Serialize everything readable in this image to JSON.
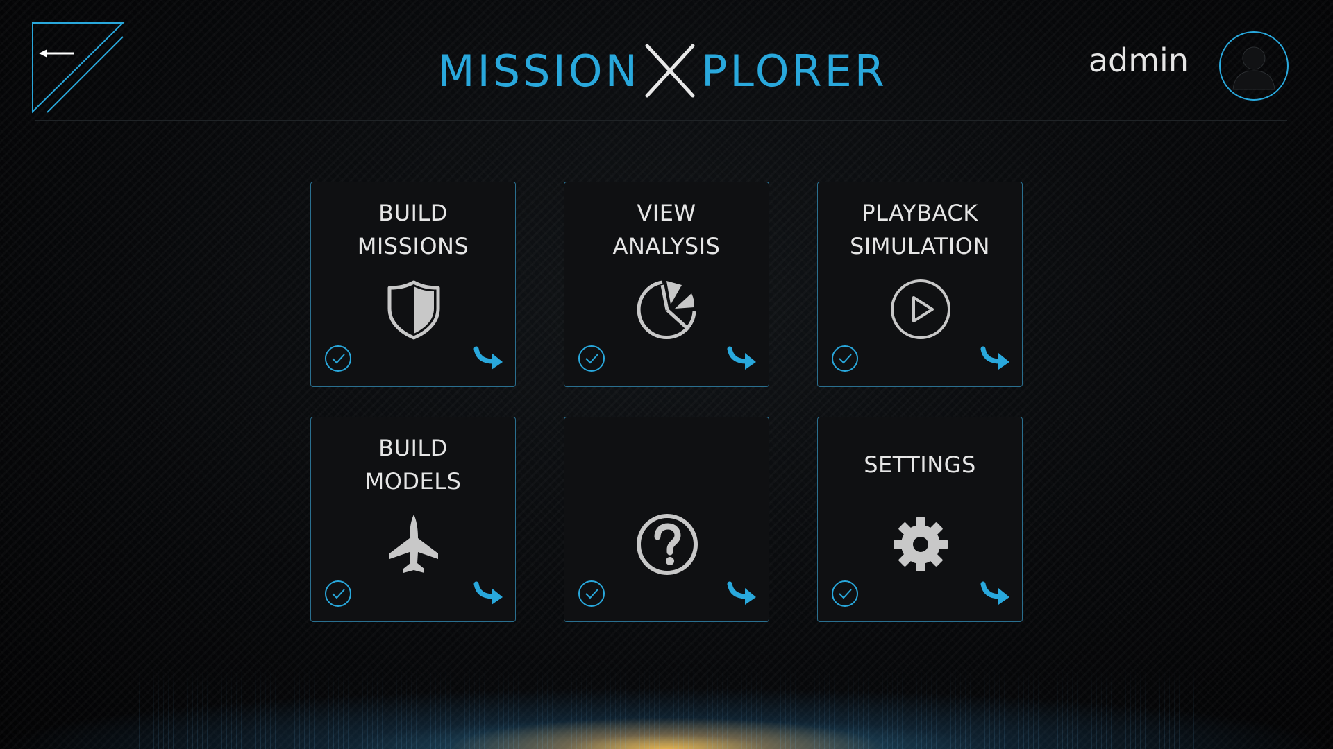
{
  "app": {
    "logo_left": "MISSION",
    "logo_x": "X",
    "logo_right": "PLORER"
  },
  "header": {
    "back_icon": "back-arrow-icon",
    "user_name": "admin",
    "avatar_icon": "user-silhouette-icon"
  },
  "colors": {
    "accent": "#29a8dc",
    "tile_border": "#2a6f8f",
    "tile_bg": "#0f1012",
    "text": "#e6e6e6",
    "icon_gray": "#c8c8c8"
  },
  "tiles": [
    {
      "title": "BUILD\nMISSIONS",
      "icon": "shield-icon",
      "check_icon": "check-circle-icon",
      "go_icon": "curved-arrow-icon"
    },
    {
      "title": "VIEW\nANALYSIS",
      "icon": "pie-chart-icon",
      "check_icon": "check-circle-icon",
      "go_icon": "curved-arrow-icon"
    },
    {
      "title": "PLAYBACK\nSIMULATION",
      "icon": "play-icon",
      "check_icon": "check-circle-icon",
      "go_icon": "curved-arrow-icon"
    },
    {
      "title": "BUILD\nMODELS",
      "icon": "jet-icon",
      "check_icon": "check-circle-icon",
      "go_icon": "curved-arrow-icon"
    },
    {
      "title": "",
      "icon": "question-icon",
      "check_icon": "check-circle-icon",
      "go_icon": "curved-arrow-icon"
    },
    {
      "title": "SETTINGS",
      "icon": "gear-icon",
      "check_icon": "check-circle-icon",
      "go_icon": "curved-arrow-icon"
    }
  ]
}
